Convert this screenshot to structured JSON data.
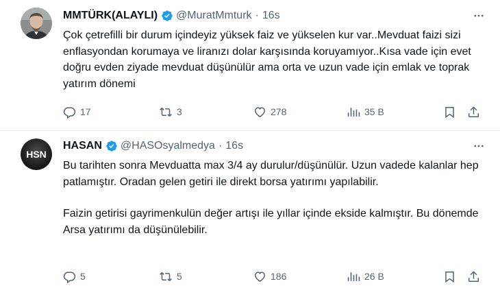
{
  "tweets": [
    {
      "author_name": "MMTÜRK(ALAYLI)",
      "handle": "@MuratMmturk",
      "separator": "·",
      "time": "16s",
      "paragraphs": [
        "Çok çetrefilli bir durum içindeyiz yüksek faiz ve yükselen kur var..Mevduat faizi sizi enflasyondan korumaya ve liranızı dolar karşısında koruyamıyor..Kısa vade için evet doğru evden ziyade mevduat düşünülür ama orta ve uzun vade için emlak ve toprak yatırım dönemi"
      ],
      "replies": "17",
      "retweets": "3",
      "likes": "278",
      "views": "35 B",
      "avatar": "user-photo",
      "verified_color": "#1d9bf0"
    },
    {
      "author_name": "HASAN",
      "handle": "@HASOsyalmedya",
      "separator": "·",
      "time": "16s",
      "paragraphs": [
        "Bu tarihten sonra Mevduatta max 3/4 ay durulur/düşünülür. Uzun vadede kalanlar hep patlamıştır. Oradan gelen getiri ile direkt borsa yatırımı yapılabilir.",
        "Faizin getirisi gayrimenkulün değer artışı ile yıllar içinde ekside kalmıştır. Bu dönemde Arsa yatırımı da düşünülebilir."
      ],
      "replies": "5",
      "retweets": "5",
      "likes": "186",
      "views": "26 B",
      "avatar_text": "HSN",
      "verified_color": "#1d9bf0"
    }
  ],
  "icons": {
    "reply": "reply-icon",
    "retweet": "retweet-icon",
    "like": "heart-icon",
    "views": "views-icon",
    "bookmark": "bookmark-icon",
    "share": "share-icon",
    "more": "more-icon",
    "verified": "verified-badge-icon"
  },
  "colors": {
    "text": "#0f1419",
    "secondary": "#536471",
    "divider": "#e6e9eb",
    "accent": "#1d9bf0"
  }
}
